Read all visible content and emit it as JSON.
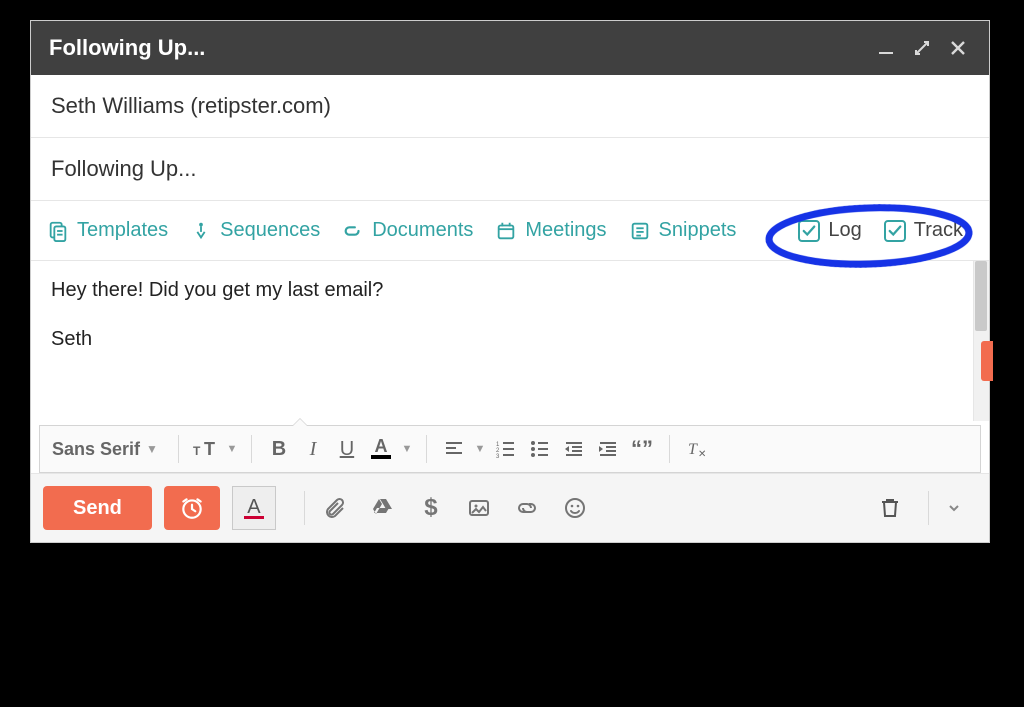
{
  "titlebar": {
    "title": "Following Up..."
  },
  "recipient": "Seth Williams (retipster.com)",
  "subject": "Following Up...",
  "hubspot": {
    "templates": "Templates",
    "sequences": "Sequences",
    "documents": "Documents",
    "meetings": "Meetings",
    "snippets": "Snippets",
    "log_label": "Log",
    "track_label": "Track",
    "log_checked": true,
    "track_checked": true
  },
  "body": {
    "line1": "Hey there! Did you get my last email?",
    "line2": "Seth"
  },
  "format": {
    "font_family": "Sans Serif"
  },
  "actions": {
    "send_label": "Send"
  },
  "colors": {
    "accent_orange": "#f26c4f",
    "accent_teal": "#33a3a3",
    "annotation_blue": "#1633e6"
  }
}
